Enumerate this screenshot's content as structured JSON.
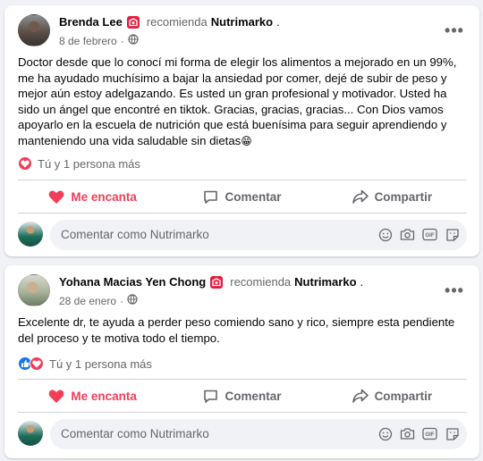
{
  "posts": [
    {
      "author": "Brenda Lee",
      "verb": "recomienda",
      "page": "Nutrimarko",
      "dot": ".",
      "date": "8 de febrero",
      "text": "Doctor desde que lo conocí mi forma de elegir los alimentos a mejorado en un 99%, me ha ayudado muchísimo a bajar la ansiedad por comer, dejé de subir de peso y mejor aún estoy adelgazando. Es usted un gran profesional y motivador. Usted ha sido un ángel que encontré en tiktok. Gracias, gracias, gracias... Con Dios vamos apoyarlo en la escuela de nutrición que está buenísima para seguir aprendiendo y manteniendo una vida saludable sin dietas",
      "emoji": "😁",
      "reactions_text": "Tú y 1 persona más",
      "reaction_icons": [
        "love-icon"
      ]
    },
    {
      "author": "Yohana Macias Yen Chong",
      "verb": "recomienda",
      "page": "Nutrimarko",
      "dot": ".",
      "date": "28 de enero",
      "text": "Excelente dr, te ayuda a perder peso comiendo sano y rico, siempre esta pendiente del proceso  y te motiva todo el tiempo.",
      "emoji": "",
      "reactions_text": "Tú y 1 persona más",
      "reaction_icons": [
        "like-icon",
        "love-icon"
      ]
    }
  ],
  "actions": {
    "love": "Me encanta",
    "comment": "Comentar",
    "share": "Compartir"
  },
  "comment_box": {
    "placeholder": "Comentar como Nutrimarko"
  },
  "more_label": "•••",
  "colors": {
    "love": "#f33e58",
    "like": "#1877f2",
    "recommend": "#e41e3f",
    "secondary_text": "#65676b"
  }
}
